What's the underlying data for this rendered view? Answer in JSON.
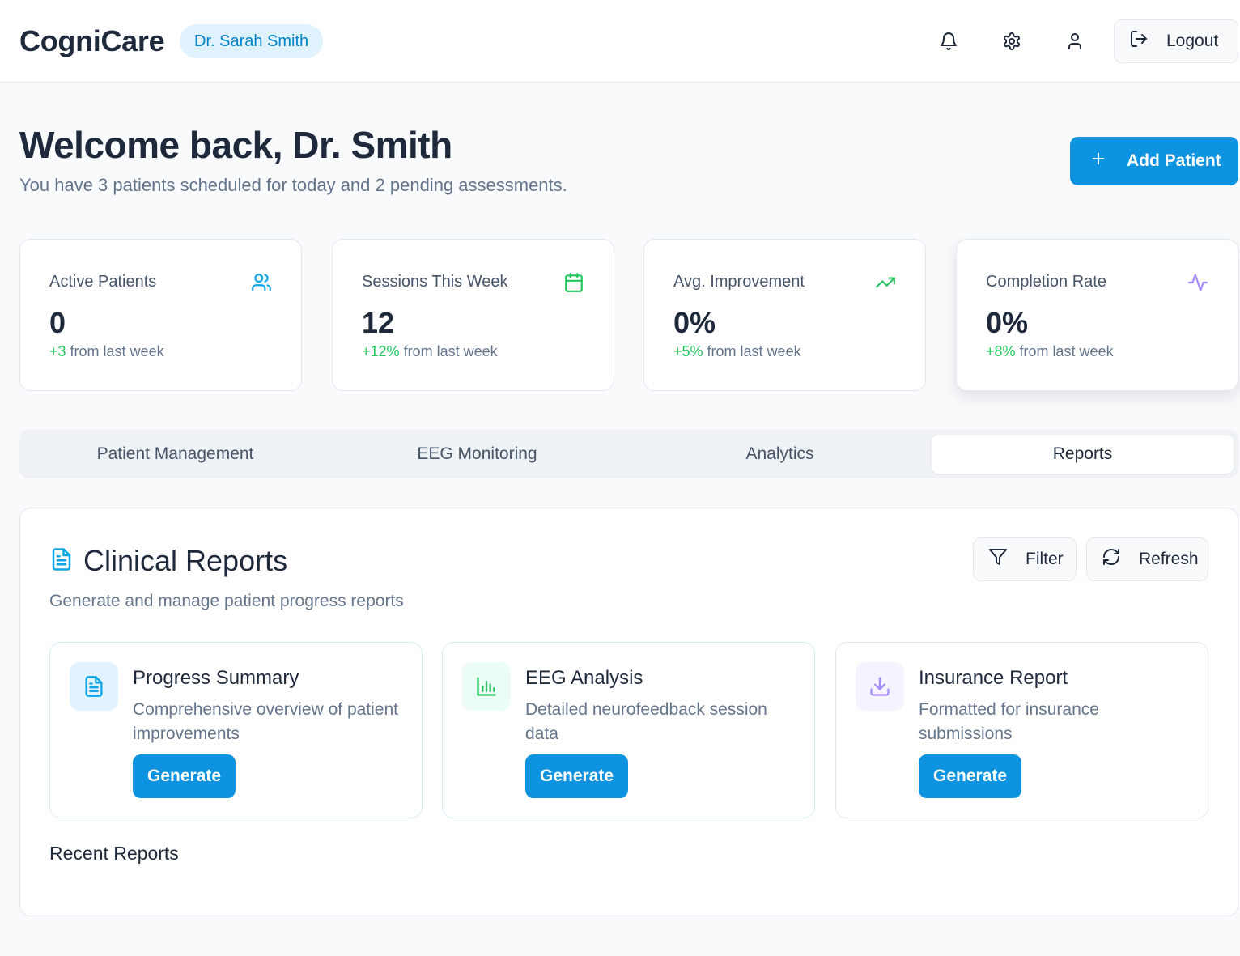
{
  "header": {
    "brand": "CogniCare",
    "doctor_name": "Dr. Sarah Smith",
    "icons": [
      "bell-icon",
      "gear-icon",
      "user-icon",
      "logout-icon"
    ],
    "logout_label": "Logout"
  },
  "welcome": {
    "title": "Welcome back, Dr. Smith",
    "subtitle": "You have 3 patients scheduled for today and 2 pending assessments.",
    "add_patient_label": "Add Patient"
  },
  "stats": [
    {
      "label": "Active Patients",
      "value": "0",
      "delta": "+3",
      "delta_suffix": "from last week",
      "icon": "users-icon",
      "icon_color": "#0ea5e9"
    },
    {
      "label": "Sessions This Week",
      "value": "12",
      "delta": "+12%",
      "delta_suffix": "from last week",
      "icon": "calendar-icon",
      "icon_color": "#22c55e"
    },
    {
      "label": "Avg. Improvement",
      "value": "0%",
      "delta": "+5%",
      "delta_suffix": "from last week",
      "icon": "trending-up-icon",
      "icon_color": "#22c55e"
    },
    {
      "label": "Completion Rate",
      "value": "0%",
      "delta": "+8%",
      "delta_suffix": "from last week",
      "icon": "activity-icon",
      "icon_color": "#a78bfa"
    }
  ],
  "tabs": [
    {
      "label": "Patient Management",
      "active": false
    },
    {
      "label": "EEG Monitoring",
      "active": false
    },
    {
      "label": "Analytics",
      "active": false
    },
    {
      "label": "Reports",
      "active": true
    }
  ],
  "reports": {
    "title": "Clinical Reports",
    "subtitle": "Generate and manage patient progress reports",
    "filter_label": "Filter",
    "refresh_label": "Refresh",
    "cards": [
      {
        "title": "Progress Summary",
        "description": "Comprehensive overview of patient improvements",
        "button": "Generate",
        "icon": "document-icon",
        "icon_color": "#0ea5e9",
        "icon_bg": "#e0f2fe"
      },
      {
        "title": "EEG Analysis",
        "description": "Detailed neurofeedback session data",
        "button": "Generate",
        "icon": "bar-chart-icon",
        "icon_color": "#22c55e",
        "icon_bg": "#ecfdf5"
      },
      {
        "title": "Insurance Report",
        "description": "Formatted for insurance submissions",
        "button": "Generate",
        "icon": "download-icon",
        "icon_color": "#a78bfa",
        "icon_bg": "#f5f3ff"
      }
    ],
    "recent_title": "Recent Reports"
  },
  "colors": {
    "primary": "#0e93e0",
    "positive": "#22c55e",
    "text": "#1e293b",
    "muted": "#64748b"
  }
}
